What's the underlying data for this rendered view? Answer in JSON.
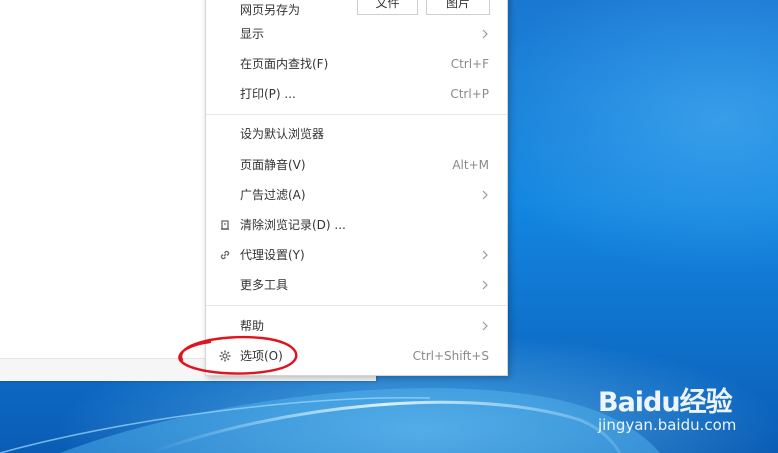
{
  "menu": {
    "top_item": {
      "label": "网页另存为",
      "file_button": "文件",
      "image_button": "图片"
    },
    "items": [
      {
        "label": "显示",
        "shortcut": "",
        "submenu": true
      },
      {
        "label": "在页面内查找(F)",
        "shortcut": "Ctrl+F",
        "submenu": false
      },
      {
        "label": "打印(P) ...",
        "shortcut": "Ctrl+P",
        "submenu": false
      },
      {
        "label": "设为默认浏览器",
        "shortcut": "",
        "submenu": false
      },
      {
        "label": "页面静音(V)",
        "shortcut": "Alt+M",
        "submenu": false
      },
      {
        "label": "广告过滤(A)",
        "shortcut": "",
        "submenu": true
      },
      {
        "label": "清除浏览记录(D) ...",
        "shortcut": "",
        "submenu": false,
        "icon": "clear-history-icon"
      },
      {
        "label": "代理设置(Y)",
        "shortcut": "",
        "submenu": true,
        "icon": "link-icon"
      },
      {
        "label": "更多工具",
        "shortcut": "",
        "submenu": true
      },
      {
        "label": "帮助",
        "shortcut": "",
        "submenu": true
      },
      {
        "label": "选项(O)",
        "shortcut": "Ctrl+Shift+S",
        "submenu": false,
        "icon": "gear-icon"
      }
    ]
  },
  "annotation": {
    "color": "#e0141e",
    "target": "选项(O)"
  },
  "watermark": {
    "logo": "Baidu经验",
    "url": "jingyan.baidu.com"
  },
  "colors": {
    "desktop": "#1386e0",
    "menu_bg": "#ffffff",
    "shortcut_text": "#8a8a8a"
  }
}
